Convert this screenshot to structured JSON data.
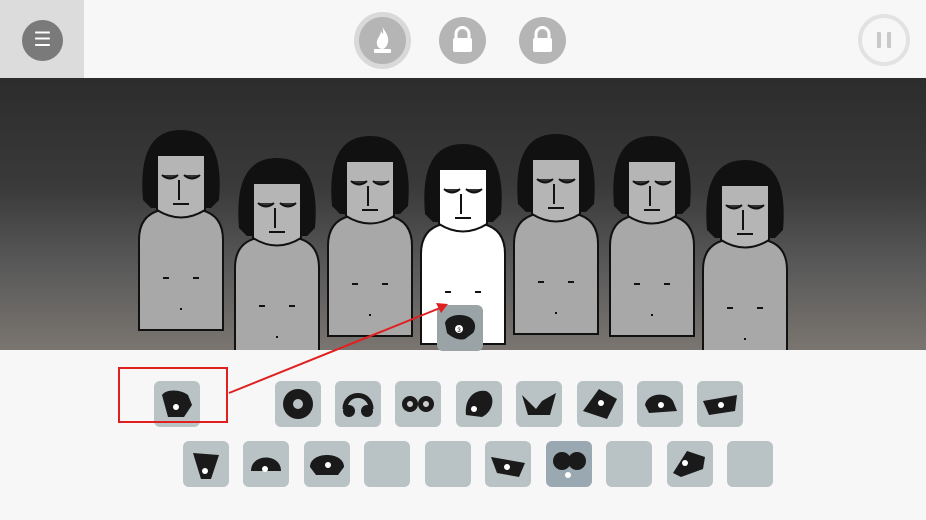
{
  "topbar": {
    "menu_icon": "hamburger-icon",
    "menu_glyph": "☰",
    "modes": [
      {
        "name": "flame-mode",
        "icon": "flame-icon",
        "state": "active"
      },
      {
        "name": "locked-mode-1",
        "icon": "lock-icon",
        "state": "locked"
      },
      {
        "name": "locked-mode-2",
        "icon": "lock-icon",
        "state": "locked"
      }
    ],
    "pause_icon": "pause-icon"
  },
  "stage": {
    "characters": [
      {
        "id": 1,
        "state": "idle"
      },
      {
        "id": 2,
        "state": "idle"
      },
      {
        "id": 3,
        "state": "idle"
      },
      {
        "id": 4,
        "state": "selected"
      },
      {
        "id": 5,
        "state": "idle"
      },
      {
        "id": 6,
        "state": "idle"
      },
      {
        "id": 7,
        "state": "idle"
      }
    ]
  },
  "tray": {
    "highlighted_slot": "helmet-shirt-icon",
    "row1": [
      "helmet-shirt-icon",
      "vinyl-icon",
      "headphones-icon",
      "goggles-icon",
      "hood-icon",
      "collar-icon",
      "wings-icon",
      "cap-icon",
      "mask-icon"
    ],
    "row2": [
      "scarf-icon",
      "beanie-icon",
      "helmet-icon",
      "empty",
      "empty",
      "visor-icon",
      "glasses-icon",
      "empty",
      "hat-icon",
      "empty"
    ]
  },
  "colors": {
    "accent_red": "#e02020",
    "slot_bg": "#b9c2c4",
    "stage_top": "#2c2c2c"
  }
}
